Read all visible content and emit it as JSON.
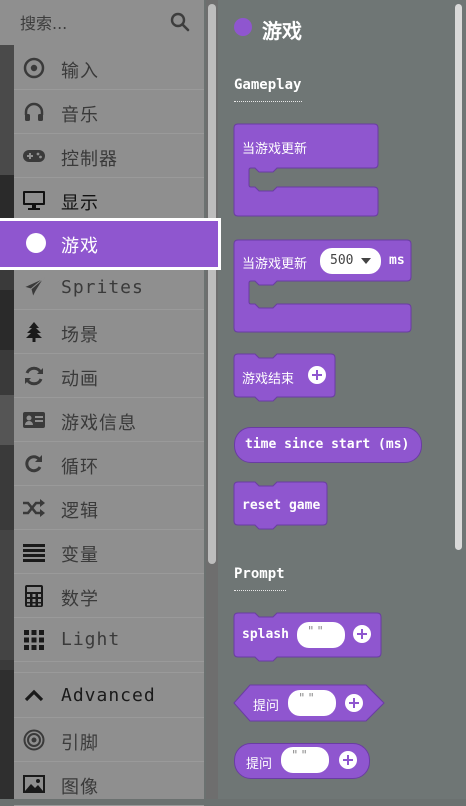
{
  "search": {
    "placeholder": "搜索...",
    "icon": "search-icon"
  },
  "categories": [
    {
      "label": "输入",
      "icon": "target-icon"
    },
    {
      "label": "音乐",
      "icon": "headphones-icon"
    },
    {
      "label": "控制器",
      "icon": "gamepad-icon"
    },
    {
      "label": "显示",
      "icon": "monitor-icon"
    },
    {
      "label": "游戏",
      "icon": "circle-icon",
      "active": true
    },
    {
      "label": "Sprites",
      "icon": "paper-plane-icon"
    },
    {
      "label": "场景",
      "icon": "tree-icon"
    },
    {
      "label": "动画",
      "icon": "refresh-icon"
    },
    {
      "label": "游戏信息",
      "icon": "id-card-icon"
    },
    {
      "label": "循环",
      "icon": "redo-icon"
    },
    {
      "label": "逻辑",
      "icon": "shuffle-icon"
    },
    {
      "label": "变量",
      "icon": "list-icon"
    },
    {
      "label": "数学",
      "icon": "calculator-icon"
    },
    {
      "label": "Light",
      "icon": "grid-icon"
    },
    {
      "label": "Advanced",
      "icon": "chevron-up-icon"
    },
    {
      "label": "引脚",
      "icon": "bullseye-icon"
    },
    {
      "label": "图像",
      "icon": "image-icon"
    }
  ],
  "flyout": {
    "title": "游戏",
    "accent": "#8f56cf",
    "sections": [
      {
        "label": "Gameplay"
      },
      {
        "label": "Prompt"
      }
    ],
    "blocks": {
      "on_update": "当游戏更新",
      "on_update_interval": "当游戏更新",
      "interval_value": "500",
      "interval_unit": "ms",
      "game_over": "游戏结束",
      "time_since_start": "time since start (ms)",
      "reset_game": "reset game",
      "splash": "splash",
      "ask_reporter": "提问",
      "ask_statement": "提问",
      "string_value": "\" \""
    }
  }
}
